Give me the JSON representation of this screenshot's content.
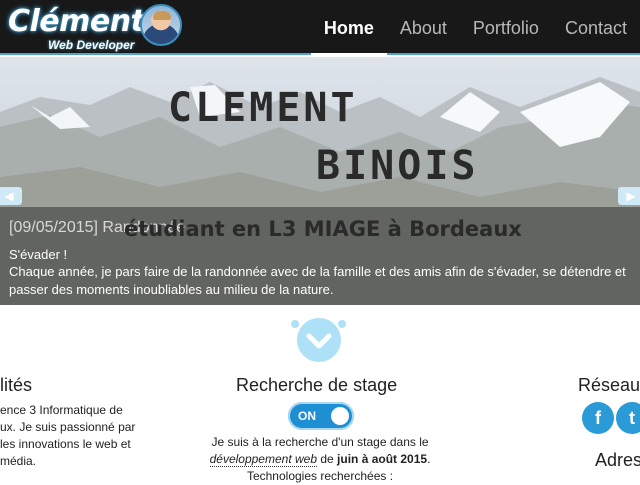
{
  "brand": {
    "name": "Clément",
    "subtitle": "Web Developer"
  },
  "nav": {
    "items": [
      {
        "label": "Home",
        "active": true
      },
      {
        "label": "About",
        "active": false
      },
      {
        "label": "Portfolio",
        "active": false
      },
      {
        "label": "Contact",
        "active": false
      }
    ]
  },
  "hero": {
    "title_line1": "CLEMENT",
    "title_line2": "BINOIS",
    "subtitle": "étudiant en L3 MIAGE à Bordeaux",
    "slide_title": "[09/05/2015] Randonnée",
    "slide_lead": "S'évader !",
    "slide_text": "Chaque année, je pars faire de la randonnée avec de la famille et des amis afin de s'évader, se détendre et passer des moments inoubliables au milieu de la nature."
  },
  "left_col": {
    "title": "lités",
    "lines": [
      "ence 3 Informatique de",
      "ux. Je suis passionné par",
      "les innovations le web et",
      "média."
    ]
  },
  "center_col": {
    "title": "Recherche de stage",
    "toggle_label": "ON",
    "text_part1": "Je suis à la recherche d'un stage dans le",
    "text_link": "développement web",
    "text_part2": " de ",
    "text_bold": "juin à août 2015",
    "text_part3": ".",
    "text_line3": "Technologies recherchées :"
  },
  "right_col": {
    "title": "Réseau",
    "title2": "Adres",
    "social": [
      {
        "icon": "facebook-icon",
        "glyph": "f"
      },
      {
        "icon": "twitter-icon",
        "glyph": "t"
      }
    ]
  },
  "colors": {
    "accent": "#2a9bd6",
    "navbar": "#181818",
    "light_accent": "#aee0f8"
  }
}
